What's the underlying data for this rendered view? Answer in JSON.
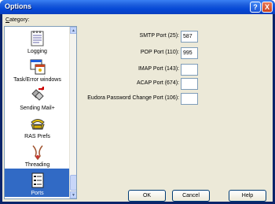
{
  "window": {
    "title": "Options"
  },
  "titlebar_buttons": {
    "help": "?",
    "close": "X"
  },
  "category_label": {
    "prefix": "",
    "accel": "C",
    "rest": "ategory:"
  },
  "categories": [
    {
      "label": "Logging",
      "icon": "logging-icon"
    },
    {
      "label": "Task/Error windows",
      "icon": "task-window-icon"
    },
    {
      "label": "Sending Mail+",
      "icon": "sending-mail-icon"
    },
    {
      "label": "RAS Prefs",
      "icon": "phone-icon"
    },
    {
      "label": "Threading",
      "icon": "threading-icon"
    },
    {
      "label": "Ports",
      "icon": "ports-icon",
      "selected": true
    }
  ],
  "fields": [
    {
      "label": "SMTP Port (25):",
      "value": "587"
    },
    {
      "label": "POP Port (110):",
      "value": "995"
    },
    {
      "label": "IMAP Port (143):",
      "value": ""
    },
    {
      "label": "ACAP Port (674):",
      "value": ""
    },
    {
      "label": "Eudora Password Change Port (106):",
      "value": ""
    }
  ],
  "buttons": {
    "ok": "OK",
    "cancel": "Cancel",
    "help": "Help"
  },
  "colors": {
    "selection": "#316ac5",
    "titlebar": "#0548d6",
    "dialog_bg": "#ece9d8"
  }
}
